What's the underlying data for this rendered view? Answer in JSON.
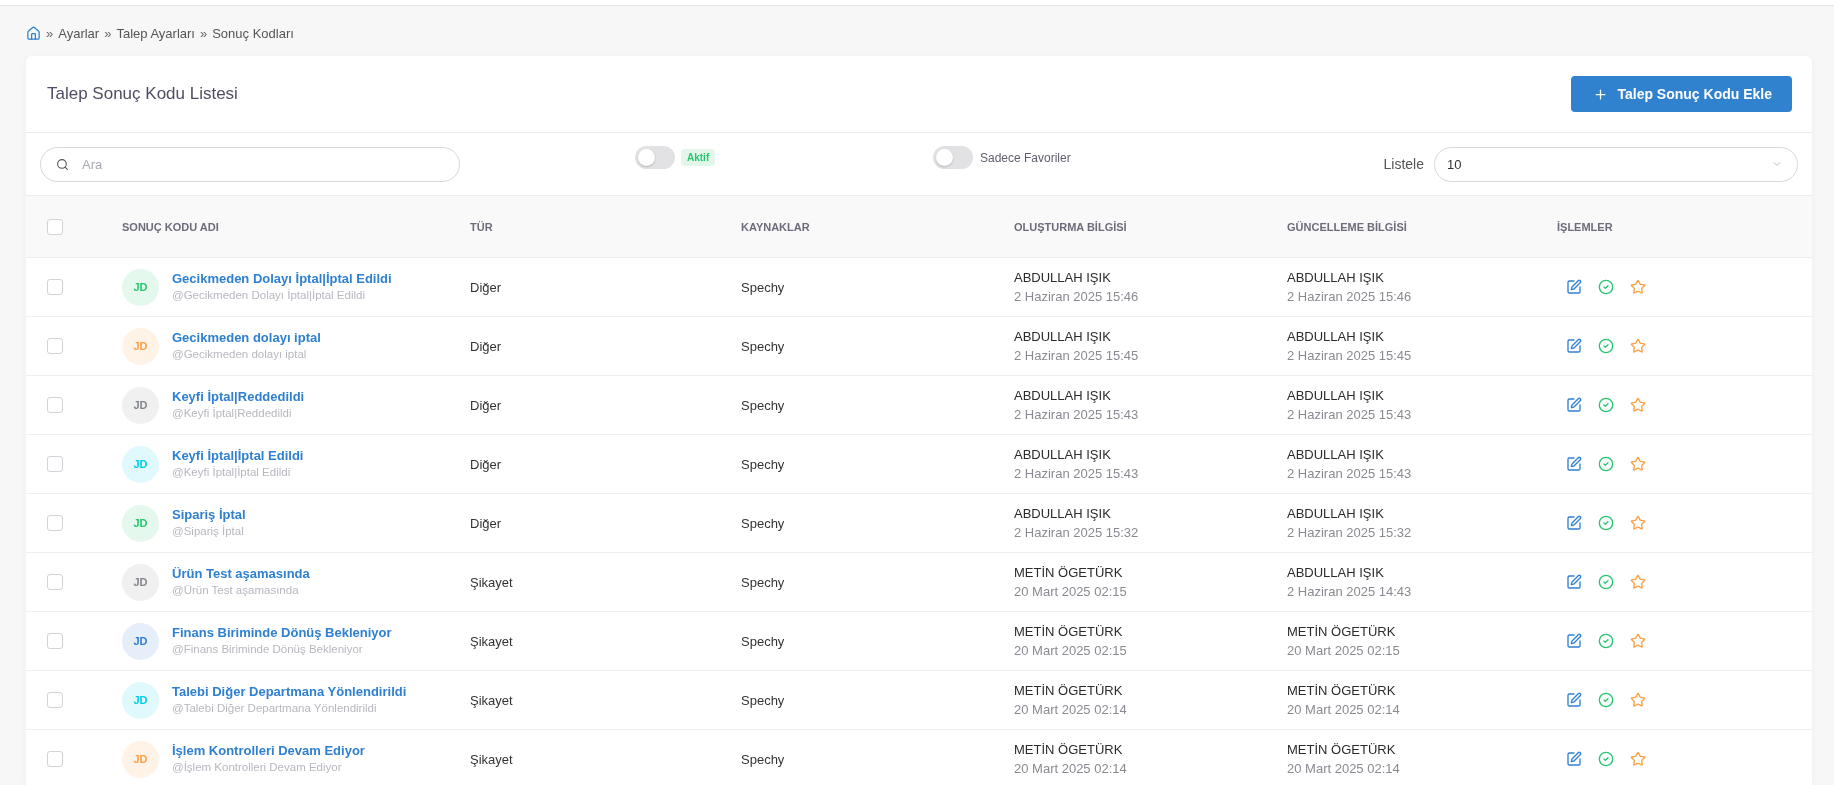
{
  "breadcrumb": {
    "items": [
      {
        "separator": "»",
        "label": "Ayarlar"
      },
      {
        "separator": "»",
        "label": "Talep Ayarları"
      },
      {
        "separator": "»",
        "label": "Sonuç Kodları"
      }
    ]
  },
  "card": {
    "title": "Talep Sonuç Kodu Listesi",
    "add_button": {
      "label": "Talep Sonuç Kodu Ekle"
    }
  },
  "filters": {
    "search": {
      "placeholder": "Ara"
    },
    "active_toggle": {
      "on": false,
      "badge": "Aktif"
    },
    "favorites_toggle": {
      "on": false,
      "label": "Sadece Favoriler"
    },
    "page_size": {
      "label": "Listele",
      "value": "10"
    }
  },
  "table": {
    "select_all": {
      "checked": false
    },
    "columns": [
      "SONUÇ KODU ADI",
      "TÜR",
      "KAYNAKLAR",
      "OLUŞTURMA BİLGİSİ",
      "GÜNCELLEME BİLGİSİ",
      "İŞLEMLER"
    ],
    "rows": [
      {
        "checked": false,
        "avatar": {
          "initials": "JD",
          "color": "#28c76f"
        },
        "name": "Gecikmeden Dolayı İptal|İptal Edildi",
        "handle": "@Gecikmeden Dolayı İptal|İptal Edildi",
        "type": "Diğer",
        "source": "Spechy",
        "created_by": "ABDULLAH IŞIK",
        "created_at": "2 Haziran 2025 15:46",
        "updated_by": "ABDULLAH IŞIK",
        "updated_at": "2 Haziran 2025 15:46",
        "favorite": false
      },
      {
        "checked": false,
        "avatar": {
          "initials": "JD",
          "color": "#ff9f43"
        },
        "name": "Gecikmeden dolayı iptal",
        "handle": "@Gecikmeden dolayı iptal",
        "type": "Diğer",
        "source": "Spechy",
        "created_by": "ABDULLAH IŞIK",
        "created_at": "2 Haziran 2025 15:45",
        "updated_by": "ABDULLAH IŞIK",
        "updated_at": "2 Haziran 2025 15:45",
        "favorite": false
      },
      {
        "checked": false,
        "avatar": {
          "initials": "JD",
          "color": "#82868b"
        },
        "name": "Keyfi İptal|Reddedildi",
        "handle": "@Keyfi İptal|Reddedildi",
        "type": "Diğer",
        "source": "Spechy",
        "created_by": "ABDULLAH IŞIK",
        "created_at": "2 Haziran 2025 15:43",
        "updated_by": "ABDULLAH IŞIK",
        "updated_at": "2 Haziran 2025 15:43",
        "favorite": false
      },
      {
        "checked": false,
        "avatar": {
          "initials": "JD",
          "color": "#00cfe8"
        },
        "name": "Keyfi İptal|İptal Edildi",
        "handle": "@Keyfi İptal|İptal Edildi",
        "type": "Diğer",
        "source": "Spechy",
        "created_by": "ABDULLAH IŞIK",
        "created_at": "2 Haziran 2025 15:43",
        "updated_by": "ABDULLAH IŞIK",
        "updated_at": "2 Haziran 2025 15:43",
        "favorite": false
      },
      {
        "checked": false,
        "avatar": {
          "initials": "JD",
          "color": "#28c76f"
        },
        "name": "Sipariş İptal",
        "handle": "@Sipariş İptal",
        "type": "Diğer",
        "source": "Spechy",
        "created_by": "ABDULLAH IŞIK",
        "created_at": "2 Haziran 2025 15:32",
        "updated_by": "ABDULLAH IŞIK",
        "updated_at": "2 Haziran 2025 15:32",
        "favorite": false
      },
      {
        "checked": false,
        "avatar": {
          "initials": "JD",
          "color": "#82868b"
        },
        "name": "Ürün Test aşamasında",
        "handle": "@Ürün Test aşamasında",
        "type": "Şikayet",
        "source": "Spechy",
        "created_by": "METİN ÖGETÜRK",
        "created_at": "20 Mart 2025 02:15",
        "updated_by": "ABDULLAH IŞIK",
        "updated_at": "2 Haziran 2025 14:43",
        "favorite": false
      },
      {
        "checked": false,
        "avatar": {
          "initials": "JD",
          "color": "#2e7dd1"
        },
        "name": "Finans Biriminde Dönüş Bekleniyor",
        "handle": "@Finans Biriminde Dönüş Bekleniyor",
        "type": "Şikayet",
        "source": "Spechy",
        "created_by": "METİN ÖGETÜRK",
        "created_at": "20 Mart 2025 02:15",
        "updated_by": "METİN ÖGETÜRK",
        "updated_at": "20 Mart 2025 02:15",
        "favorite": false
      },
      {
        "checked": false,
        "avatar": {
          "initials": "JD",
          "color": "#00cfe8"
        },
        "name": "Talebi Diğer Departmana Yönlendirildi",
        "handle": "@Talebi Diğer Departmana Yönlendirildi",
        "type": "Şikayet",
        "source": "Spechy",
        "created_by": "METİN ÖGETÜRK",
        "created_at": "20 Mart 2025 02:14",
        "updated_by": "METİN ÖGETÜRK",
        "updated_at": "20 Mart 2025 02:14",
        "favorite": false
      },
      {
        "checked": false,
        "avatar": {
          "initials": "JD",
          "color": "#ff9f43"
        },
        "name": "İşlem Kontrolleri Devam Ediyor",
        "handle": "@İşlem Kontrolleri Devam Ediyor",
        "type": "Şikayet",
        "source": "Spechy",
        "created_by": "METİN ÖGETÜRK",
        "created_at": "20 Mart 2025 02:14",
        "updated_by": "METİN ÖGETÜRK",
        "updated_at": "20 Mart 2025 02:14",
        "favorite": false
      }
    ]
  }
}
